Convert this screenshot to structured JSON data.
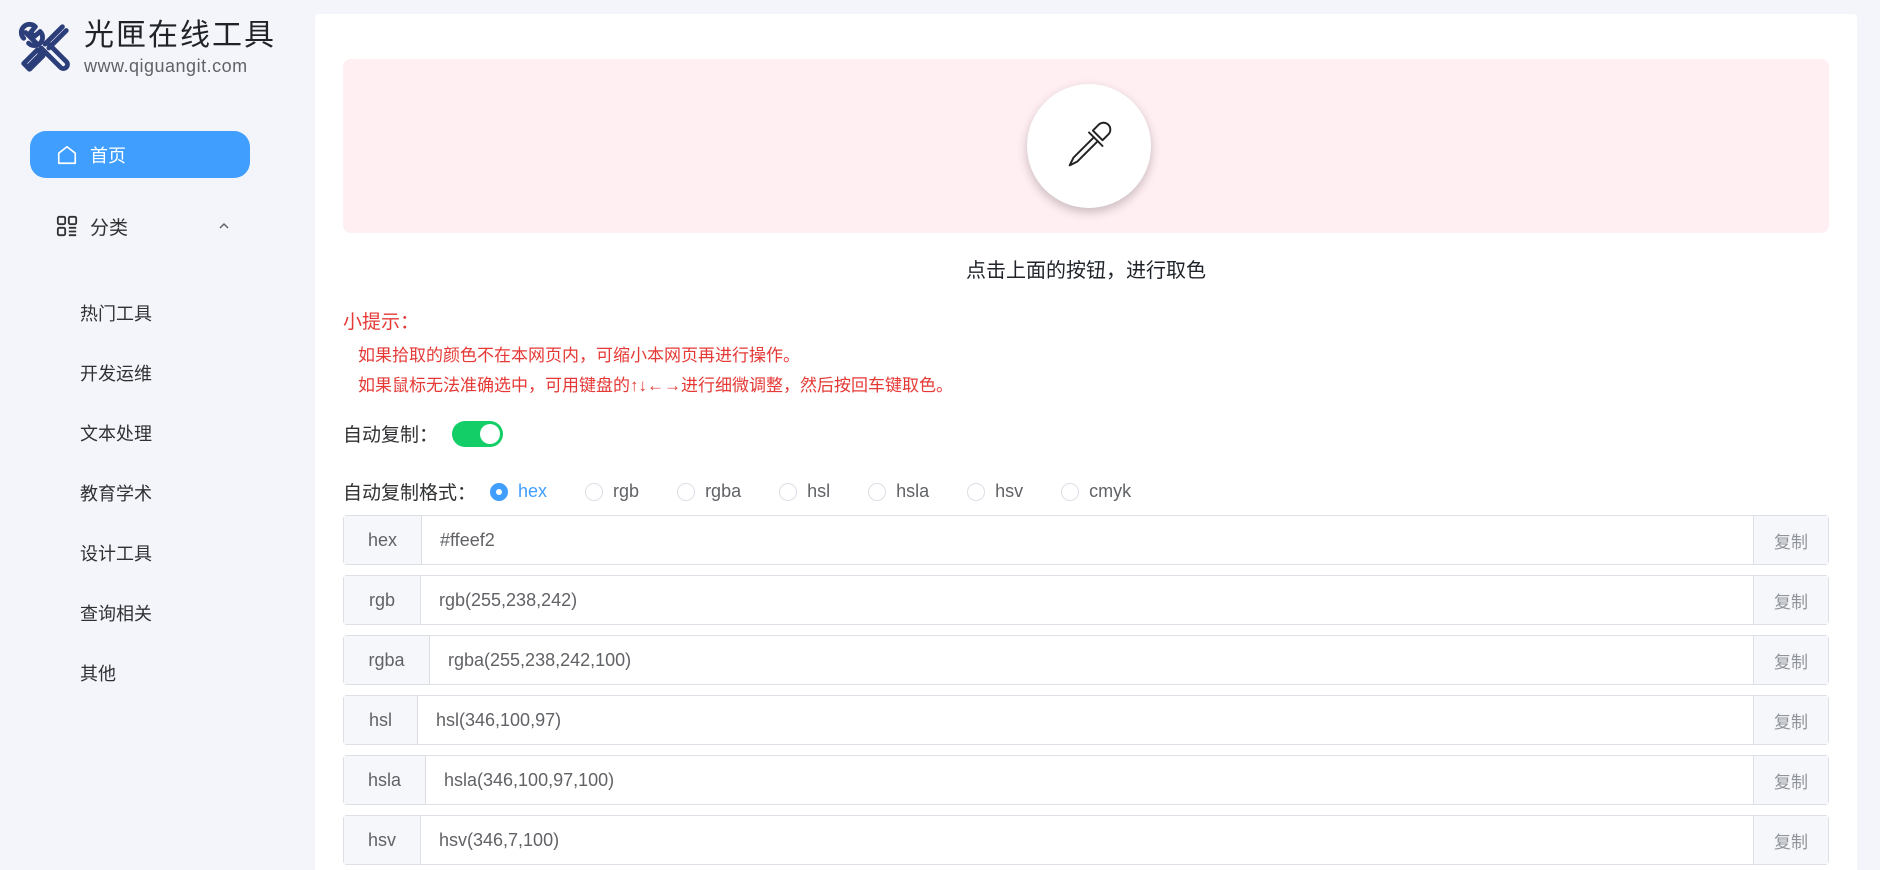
{
  "brand": {
    "title": "光匣在线工具",
    "url": "www.qiguangit.com",
    "logo_icon": "wrench-tools-icon",
    "color": "#2c3e7a"
  },
  "sidebar": {
    "home_label": "首页",
    "category_label": "分类",
    "items": [
      {
        "label": "热门工具"
      },
      {
        "label": "开发运维"
      },
      {
        "label": "文本处理"
      },
      {
        "label": "教育学术"
      },
      {
        "label": "设计工具"
      },
      {
        "label": "查询相关"
      },
      {
        "label": "其他"
      }
    ]
  },
  "picker": {
    "background": "#ffeef2",
    "icon": "eyedropper-icon",
    "caption": "点击上面的按钮，进行取色"
  },
  "tips": {
    "title": "小提示：",
    "lines": [
      "如果拾取的颜色不在本网页内，可缩小本网页再进行操作。",
      "如果鼠标无法准确选中，可用键盘的↑↓←→进行细微调整，然后按回车键取色。"
    ]
  },
  "auto_copy": {
    "label": "自动复制：",
    "enabled": true
  },
  "format": {
    "label": "自动复制格式：",
    "selected": "hex",
    "options": [
      "hex",
      "rgb",
      "rgba",
      "hsl",
      "hsla",
      "hsv",
      "cmyk"
    ]
  },
  "values": [
    {
      "label": "hex",
      "value": "#ffeef2",
      "copy": "复制"
    },
    {
      "label": "rgb",
      "value": "rgb(255,238,242)",
      "copy": "复制"
    },
    {
      "label": "rgba",
      "value": "rgba(255,238,242,100)",
      "copy": "复制"
    },
    {
      "label": "hsl",
      "value": "hsl(346,100,97)",
      "copy": "复制"
    },
    {
      "label": "hsla",
      "value": "hsla(346,100,97,100)",
      "copy": "复制"
    },
    {
      "label": "hsv",
      "value": "hsv(346,7,100)",
      "copy": "复制"
    }
  ],
  "colors": {
    "accent": "#409eff",
    "toggle_on": "#13ce66",
    "tip": "#e53935"
  }
}
